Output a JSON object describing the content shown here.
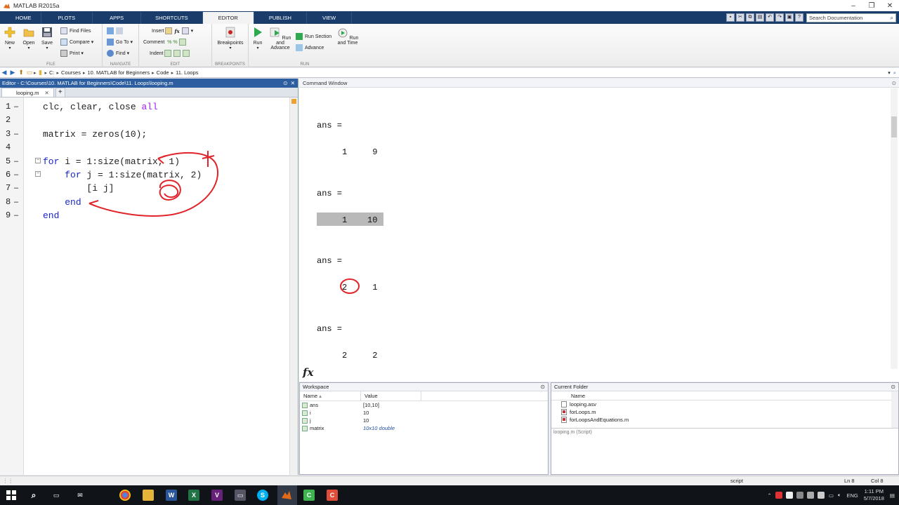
{
  "window": {
    "title": "MATLAB R2015a"
  },
  "ribbon_tabs": [
    "HOME",
    "PLOTS",
    "APPS",
    "SHORTCUTS",
    "EDITOR",
    "PUBLISH",
    "VIEW"
  ],
  "active_tab": "EDITOR",
  "search": {
    "placeholder": "Search Documentation"
  },
  "ribbon": {
    "file": {
      "label": "FILE",
      "new": "New",
      "open": "Open",
      "save": "Save",
      "find_files": "Find Files",
      "compare": "Compare",
      "print": "Print"
    },
    "navigate": {
      "label": "NAVIGATE",
      "go_to": "Go To",
      "find": "Find"
    },
    "edit": {
      "label": "EDIT",
      "insert": "Insert",
      "comment": "Comment",
      "indent": "Indent",
      "fx": "fx"
    },
    "breakpoints": {
      "label": "BREAKPOINTS",
      "breakpoints": "Breakpoints"
    },
    "run": {
      "label": "RUN",
      "run": "Run",
      "run_and_advance": "Run and Advance",
      "run_section": "Run Section",
      "advance": "Advance",
      "run_and_time": "Run and Time"
    }
  },
  "address": {
    "crumbs": [
      "C:",
      "Courses",
      "10. MATLAB for Beginners",
      "Code",
      "11. Loops"
    ]
  },
  "editor": {
    "title": "Editor - C:\\Courses\\10. MATLAB for Beginners\\Code\\11. Loops\\looping.m",
    "tab": "looping.m",
    "lines": [
      {
        "n": "1",
        "parts": [
          [
            "",
            "clc, clear, close "
          ],
          [
            "str",
            "all"
          ]
        ]
      },
      {
        "n": "2",
        "parts": []
      },
      {
        "n": "3",
        "parts": [
          [
            "",
            "matrix = zeros(10);"
          ]
        ]
      },
      {
        "n": "4",
        "parts": []
      },
      {
        "n": "5",
        "parts": [
          [
            "kw",
            "for"
          ],
          [
            "",
            " i = 1:size(matrix, 1)"
          ]
        ]
      },
      {
        "n": "6",
        "parts": [
          [
            "",
            "    "
          ],
          [
            "kw",
            "for"
          ],
          [
            "",
            " j = 1:size(matrix, 2)"
          ]
        ]
      },
      {
        "n": "7",
        "parts": [
          [
            "",
            "        [i j]"
          ]
        ]
      },
      {
        "n": "8",
        "parts": [
          [
            "",
            "    "
          ],
          [
            "kw",
            "end"
          ]
        ]
      },
      {
        "n": "9",
        "parts": [
          [
            "kw",
            "end"
          ]
        ]
      }
    ]
  },
  "command_window": {
    "title": "Command Window",
    "outputs": [
      {
        "label": "ans =",
        "row": "     1     9"
      },
      {
        "label": "ans =",
        "row": "     1    10"
      },
      {
        "label": "ans =",
        "row": "     2     1"
      },
      {
        "label": "ans =",
        "row": "     2     2"
      }
    ],
    "prompt": "fx"
  },
  "workspace": {
    "title": "Workspace",
    "columns": [
      "Name",
      "Value"
    ],
    "rows": [
      {
        "name": "ans",
        "value": "[10,10]"
      },
      {
        "name": "i",
        "value": "10"
      },
      {
        "name": "j",
        "value": "10"
      },
      {
        "name": "matrix",
        "value": "10x10 double"
      }
    ]
  },
  "current_folder": {
    "title": "Current Folder",
    "column": "Name",
    "files": [
      "looping.asv",
      "forLoops.m",
      "forLoopsAndEquations.m"
    ],
    "detail": "looping.m  (Script)"
  },
  "status": {
    "mode": "script",
    "ln": "Ln  8",
    "col": "Col  8"
  },
  "taskbar": {
    "lang": "ENG",
    "time": "1:11 PM",
    "date": "5/7/2018"
  }
}
